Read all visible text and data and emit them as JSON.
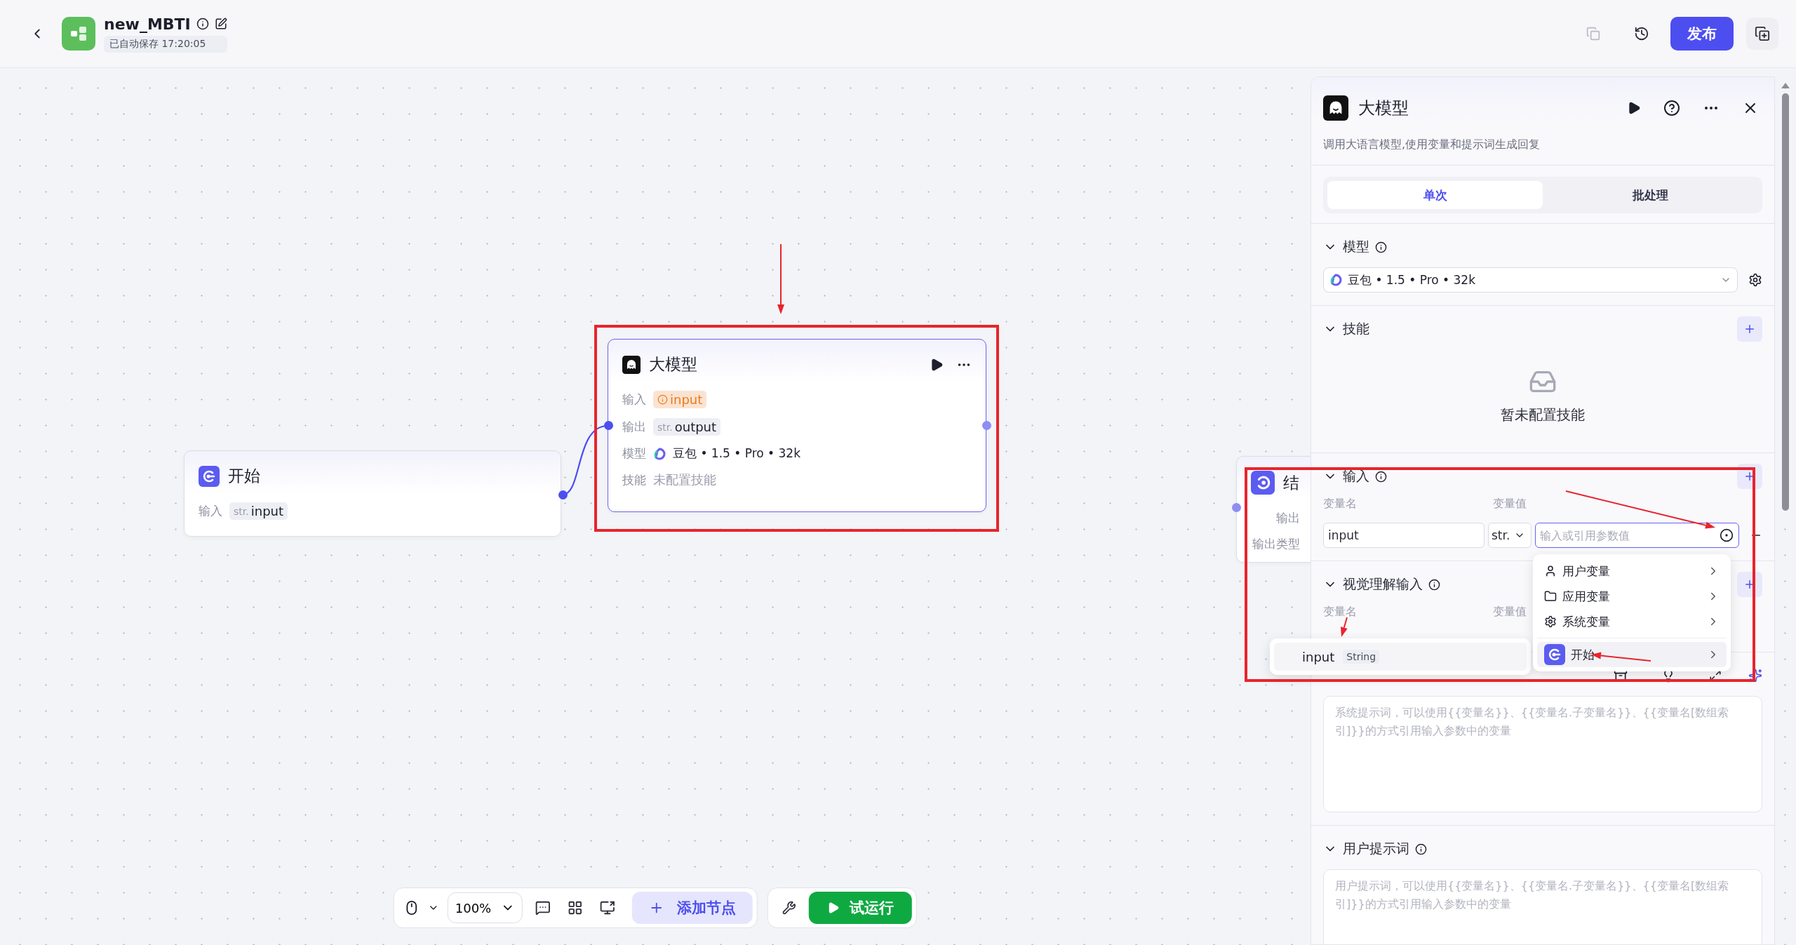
{
  "header": {
    "title": "new_MBTI",
    "autosave": "已自动保存 17:20:05",
    "publish": "发布"
  },
  "canvas": {
    "nodes": [
      {
        "kind": "start",
        "title": "开始",
        "selected": false,
        "rows": [
          {
            "label": "输入",
            "kind": "tag",
            "type": "str.",
            "value": "input"
          }
        ]
      },
      {
        "kind": "llm",
        "title": "大模型",
        "selected": true,
        "rows": [
          {
            "label": "输入",
            "kind": "warning",
            "value": "input"
          },
          {
            "label": "输出",
            "kind": "tag",
            "type": "str.",
            "value": "output"
          },
          {
            "label": "模型",
            "kind": "model",
            "value": "豆包 • 1.5 • Pro • 32k"
          },
          {
            "label": "技能",
            "kind": "muted",
            "value": "未配置技能"
          }
        ]
      },
      {
        "kind": "end",
        "title": "结",
        "selected": false,
        "rows": [
          {
            "label": "输出",
            "kind": "label"
          },
          {
            "label": "输出类型",
            "kind": "label"
          }
        ]
      }
    ]
  },
  "toolbar": {
    "zoom": "100%",
    "add_node": "添加节点",
    "test_run": "试运行"
  },
  "panel": {
    "title": "大模型",
    "description": "调用大语言模型,使用变量和提示词生成回复",
    "tabs": [
      {
        "label": "单次",
        "selected": true
      },
      {
        "label": "批处理",
        "selected": false
      }
    ],
    "model_section": {
      "title": "模型",
      "model": "豆包 • 1.5 • Pro • 32k"
    },
    "skills_section": {
      "title": "技能",
      "empty": "暂未配置技能"
    },
    "input_section": {
      "title": "输入",
      "name_label": "变量名",
      "value_label": "变量值",
      "rows": [
        {
          "name": "input",
          "type": "str.",
          "placeholder": "输入或引用参数值"
        }
      ]
    },
    "vision_section": {
      "title": "视觉理解输入",
      "name_label": "变量名",
      "value_label": "变量值"
    },
    "system_prompt": {
      "placeholder": "系统提示词，可以使用{{变量名}}、{{变量名.子变量名}}、{{变量名[数组索引]}}的方式引用输入参数中的变量"
    },
    "user_prompt": {
      "title": "用户提示词",
      "placeholder": "用户提示词，可以使用{{变量名}}、{{变量名.子变量名}}、{{变量名[数组索引]}}的方式引用输入参数中的变量"
    }
  },
  "reference_menu": {
    "items": [
      {
        "kind": "user",
        "label": "用户变量",
        "selected": false
      },
      {
        "kind": "app",
        "label": "应用变量",
        "selected": false
      },
      {
        "kind": "system",
        "label": "系统变量",
        "selected": false
      },
      {
        "kind": "node",
        "label": "开始",
        "selected": true
      }
    ],
    "submenu": {
      "name": "input",
      "type": "String"
    }
  }
}
